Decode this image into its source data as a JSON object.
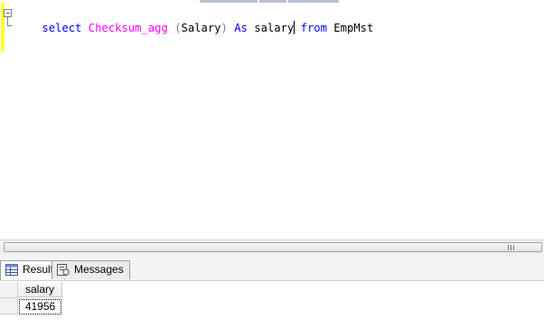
{
  "editor": {
    "tokens": [
      {
        "text": "select ",
        "cls": "kw"
      },
      {
        "text": "Checksum_agg",
        "cls": "fn"
      },
      {
        "text": " ",
        "cls": "pl"
      },
      {
        "text": "(",
        "cls": "gr"
      },
      {
        "text": "Salary",
        "cls": "pl"
      },
      {
        "text": ")",
        "cls": "gr"
      },
      {
        "text": " ",
        "cls": "pl"
      },
      {
        "text": "As",
        "cls": "kw"
      },
      {
        "text": " salary",
        "cls": "pl"
      }
    ],
    "tokens_after_caret": [
      {
        "text": " ",
        "cls": "pl"
      },
      {
        "text": "from",
        "cls": "kw"
      },
      {
        "text": " EmpMst",
        "cls": "pl"
      }
    ]
  },
  "tabs": {
    "results_label": "Results",
    "messages_label": "Messages"
  },
  "grid": {
    "columns": [
      "salary"
    ],
    "rows": [
      [
        "41956"
      ]
    ]
  }
}
